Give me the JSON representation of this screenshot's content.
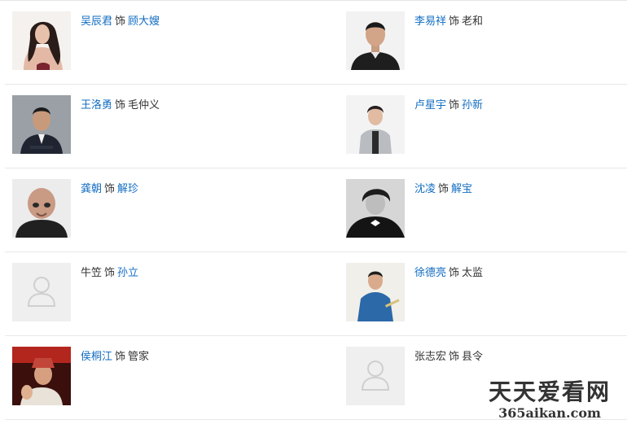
{
  "cast": [
    {
      "actor": "吴辰君",
      "sep": "饰",
      "role": "顾大嫂",
      "actor_link": true,
      "role_link": true,
      "photo": "female-portrait"
    },
    {
      "actor": "李易祥",
      "sep": "饰",
      "role": "老和",
      "actor_link": true,
      "role_link": false,
      "photo": "male-portrait"
    },
    {
      "actor": "王洛勇",
      "sep": "饰",
      "role": "毛仲义",
      "actor_link": true,
      "role_link": false,
      "photo": "male-suit-portrait"
    },
    {
      "actor": "卢星宇",
      "sep": "饰",
      "role": "孙新",
      "actor_link": true,
      "role_link": true,
      "photo": "male-portrait"
    },
    {
      "actor": "龚朝",
      "sep": "饰",
      "role": "解珍",
      "actor_link": true,
      "role_link": true,
      "photo": "bald-male-portrait"
    },
    {
      "actor": "沈凌",
      "sep": "饰",
      "role": "解宝",
      "actor_link": true,
      "role_link": true,
      "photo": "male-bw-portrait"
    },
    {
      "actor": "牛笠",
      "sep": "饰",
      "role": "孙立",
      "actor_link": false,
      "role_link": true,
      "photo": "placeholder-avatar"
    },
    {
      "actor": "徐德亮",
      "sep": "饰",
      "role": "太监",
      "actor_link": true,
      "role_link": false,
      "photo": "male-blue-robe-portrait"
    },
    {
      "actor": "侯桐江",
      "sep": "饰",
      "role": "管家",
      "actor_link": true,
      "role_link": false,
      "photo": "male-costume-portrait"
    },
    {
      "actor": "张志宏",
      "sep": "饰",
      "role": "县令",
      "actor_link": false,
      "role_link": false,
      "photo": "placeholder-avatar"
    }
  ],
  "watermark": {
    "title": "天天爱看网",
    "url": "365aikan.com"
  },
  "colors": {
    "link": "#136ec2",
    "text": "#333333",
    "divider": "#e8e8e8",
    "placeholder_bg": "#efefef"
  }
}
